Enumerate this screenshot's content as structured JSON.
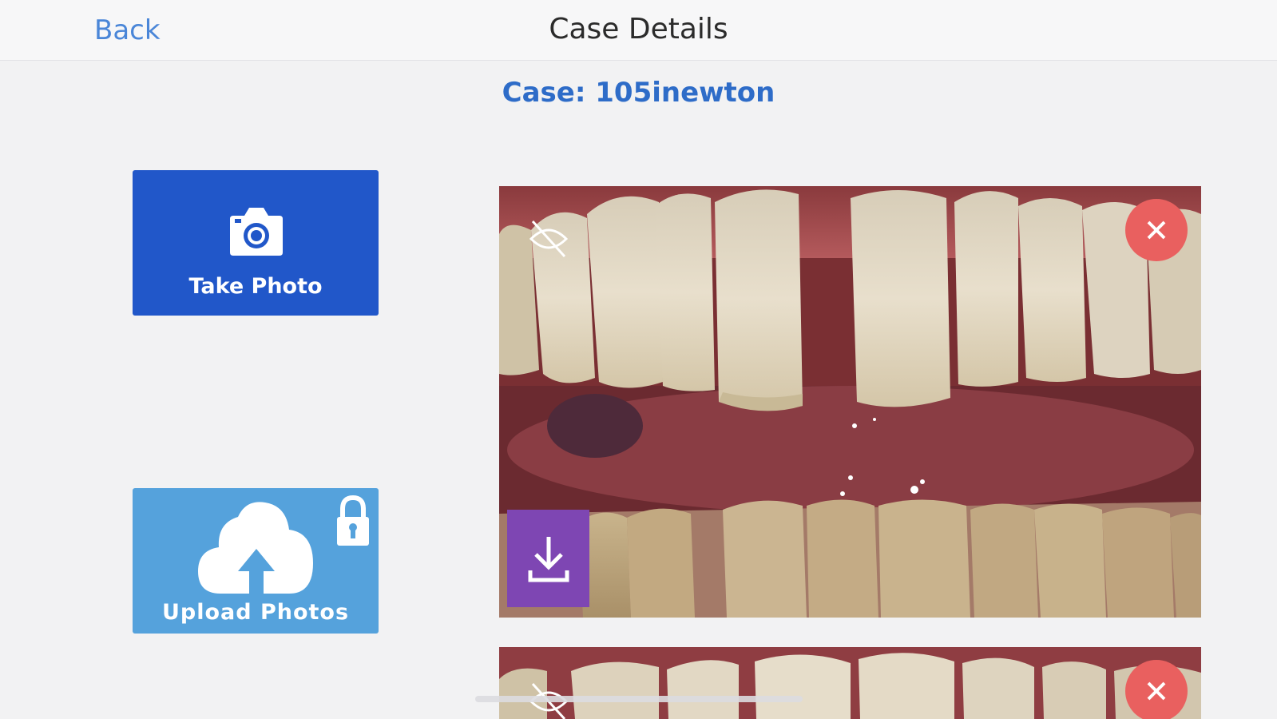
{
  "navbar": {
    "back_label": "Back",
    "title": "Case Details"
  },
  "case": {
    "title": "Case: 105inewton"
  },
  "actions": {
    "take_photo_label": "Take Photo",
    "upload_photos_label": "Upload Photos"
  },
  "photos": [
    {
      "hidden_icon": "eye-slash-icon",
      "delete_icon": "close-icon",
      "download_icon": "download-icon"
    },
    {
      "hidden_icon": "eye-slash-icon",
      "delete_icon": "close-icon"
    }
  ],
  "colors": {
    "accent_blue": "#2157c9",
    "upload_blue": "#55a2dc",
    "link_blue": "#4a86d8",
    "case_title_blue": "#2e6cc8",
    "delete_red": "#e9605f",
    "download_purple": "#7e46b3",
    "background": "#f2f2f3"
  }
}
